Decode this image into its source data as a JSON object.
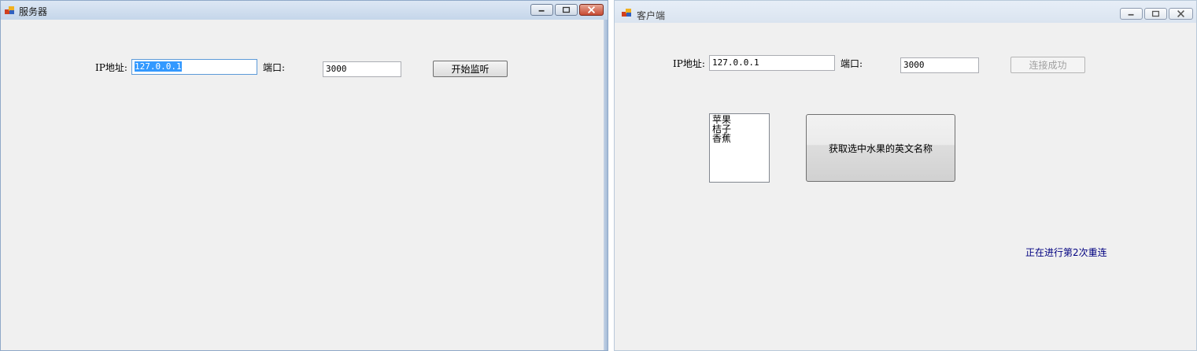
{
  "server": {
    "title": "服务器",
    "ip_label": "IP地址:",
    "ip_value": "127.0.0.1",
    "port_label": "端口:",
    "port_value": "3000",
    "listen_button": "开始监听"
  },
  "client": {
    "title": "客户端",
    "ip_label": "IP地址:",
    "ip_value": "127.0.0.1",
    "port_label": "端口:",
    "port_value": "3000",
    "connect_button": "连接成功",
    "fruits": [
      "苹果",
      "桔子",
      "香蕉"
    ],
    "fetch_button": "获取选中水果的英文名称",
    "status": "正在进行第2次重连"
  },
  "colors": {
    "status_text": "#000080",
    "selection": "#3399ff"
  }
}
